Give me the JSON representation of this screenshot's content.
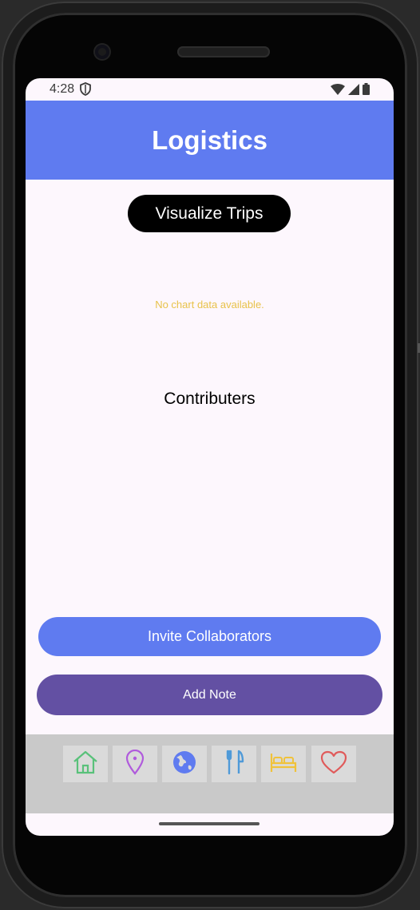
{
  "status_bar": {
    "time": "4:28"
  },
  "header": {
    "title": "Logistics"
  },
  "main": {
    "visualize_label": "Visualize Trips",
    "chart_empty_message": "No chart data available.",
    "contributors_heading": "Contributers",
    "invite_label": "Invite Collaborators",
    "add_note_label": "Add Note"
  },
  "bottom_nav": {
    "items": [
      {
        "icon": "home-icon",
        "color": "#59c17a"
      },
      {
        "icon": "location-pin-icon",
        "color": "#b05bdc"
      },
      {
        "icon": "globe-icon",
        "color": "#5f7bf0"
      },
      {
        "icon": "fork-knife-icon",
        "color": "#4f9ad8"
      },
      {
        "icon": "bed-icon",
        "color": "#f0c23a"
      },
      {
        "icon": "heart-icon",
        "color": "#e05a5a"
      }
    ]
  },
  "colors": {
    "primary": "#5f7bf0",
    "secondary": "#6350a3",
    "empty_text": "#e8c24a"
  }
}
